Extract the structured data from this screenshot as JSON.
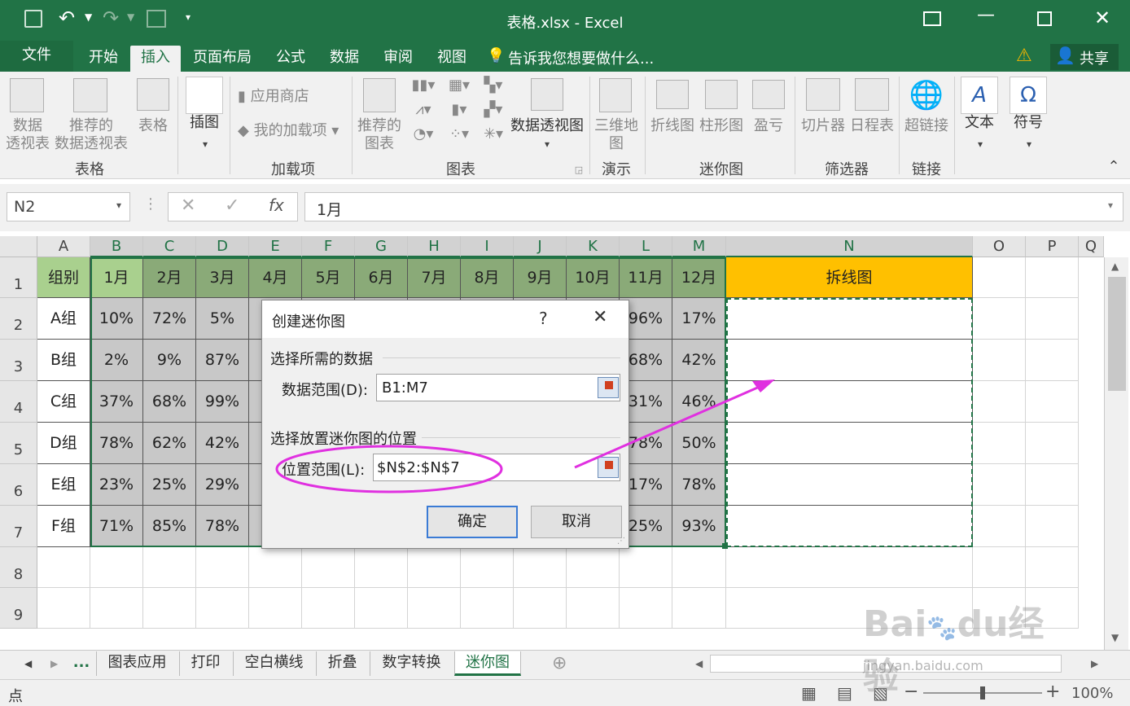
{
  "window": {
    "title": "表格.xlsx - Excel"
  },
  "tabs": [
    "文件",
    "开始",
    "插入",
    "页面布局",
    "公式",
    "数据",
    "审阅",
    "视图"
  ],
  "tellme": "告诉我您想要做什么...",
  "share": "共享",
  "ribbon": {
    "pivot": "数据\n透视表",
    "rec_pivot": "推荐的\n数据透视表",
    "table": "表格",
    "illus": "插图",
    "store": "应用商店",
    "myaddins": "我的加载项",
    "rec_chart": "推荐的\n图表",
    "pivotchart": "数据透视图",
    "map3d": "三维地\n图",
    "spark_line": "折线图",
    "spark_col": "柱形图",
    "spark_wl": "盈亏",
    "slicer": "切片器",
    "timeline": "日程表",
    "hyperlink": "超链接",
    "text": "文本",
    "symbol": "符号",
    "groups": {
      "tables": "表格",
      "addins": "加载项",
      "charts": "图表",
      "tours": "演示",
      "sparklines": "迷你图",
      "filters": "筛选器",
      "links": "链接"
    }
  },
  "formula": {
    "namebox": "N2",
    "fx": "fx",
    "value": "1月"
  },
  "columns": [
    "A",
    "B",
    "C",
    "D",
    "E",
    "F",
    "G",
    "H",
    "I",
    "J",
    "K",
    "L",
    "M",
    "N",
    "O",
    "P",
    "Q"
  ],
  "rows": [
    "1",
    "2",
    "3",
    "4",
    "5",
    "6",
    "7",
    "8",
    "9"
  ],
  "table": {
    "header": [
      "组别",
      "1月",
      "2月",
      "3月",
      "4月",
      "5月",
      "6月",
      "7月",
      "8月",
      "9月",
      "10月",
      "11月",
      "12月"
    ],
    "n1": "拆线图",
    "data": [
      [
        "A组",
        "10%",
        "72%",
        "5%",
        "96%",
        "17%"
      ],
      [
        "B组",
        "2%",
        "9%",
        "87%",
        "68%",
        "42%"
      ],
      [
        "C组",
        "37%",
        "68%",
        "99%",
        "31%",
        "46%"
      ],
      [
        "D组",
        "78%",
        "62%",
        "42%",
        "78%",
        "50%"
      ],
      [
        "E组",
        "23%",
        "25%",
        "29%",
        "17%",
        "78%"
      ],
      [
        "F组",
        "71%",
        "85%",
        "78%",
        "25%",
        "93%"
      ]
    ]
  },
  "dialog": {
    "title": "创建迷你图",
    "help": "?",
    "close": "✕",
    "section1": "选择所需的数据",
    "data_label": "数据范围(D):",
    "data_value": "B1:M7",
    "section2": "选择放置迷你图的位置",
    "loc_label": "位置范围(L):",
    "loc_value": "$N$2:$N$7",
    "ok": "确定",
    "cancel": "取消"
  },
  "sheets": [
    "...",
    "图表应用",
    "打印",
    "空白横线",
    "折叠",
    "数字转换",
    "迷你图"
  ],
  "status": {
    "mode": "点",
    "zoom": "100%"
  },
  "watermark": "Baidu经验 jingyan.baidu.com",
  "colors": {
    "green": "#217346",
    "selected_green": "#a9d08e",
    "header_green": "#8aaa78",
    "orange": "#ffc000",
    "magenta": "#e030e0"
  }
}
